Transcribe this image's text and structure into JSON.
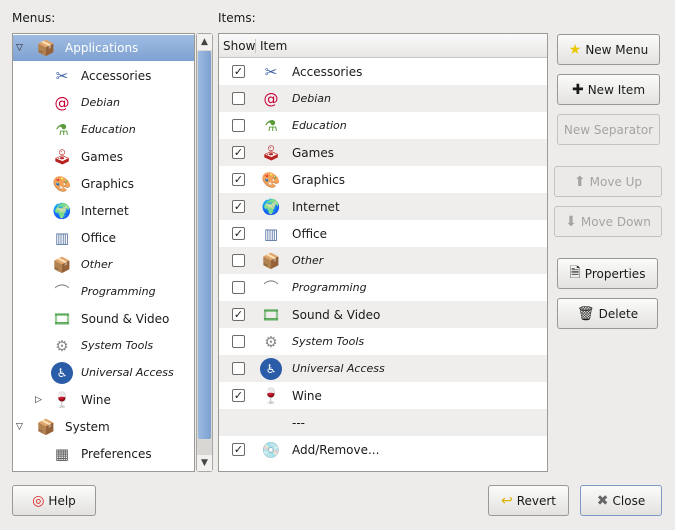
{
  "menus_label": "Menus:",
  "items_label": "Items:",
  "tree": [
    {
      "label": "Applications",
      "icon": "applications-icon",
      "expanded": true,
      "selected": true,
      "level": 0,
      "italic": false
    },
    {
      "label": "Accessories",
      "icon": "accessories-icon",
      "level": 1,
      "italic": false
    },
    {
      "label": "Debian",
      "icon": "debian-icon",
      "level": 1,
      "italic": true
    },
    {
      "label": "Education",
      "icon": "education-icon",
      "level": 1,
      "italic": true
    },
    {
      "label": "Games",
      "icon": "games-icon",
      "level": 1,
      "italic": false
    },
    {
      "label": "Graphics",
      "icon": "graphics-icon",
      "level": 1,
      "italic": false
    },
    {
      "label": "Internet",
      "icon": "internet-icon",
      "level": 1,
      "italic": false
    },
    {
      "label": "Office",
      "icon": "office-icon",
      "level": 1,
      "italic": false
    },
    {
      "label": "Other",
      "icon": "other-icon",
      "level": 1,
      "italic": true
    },
    {
      "label": "Programming",
      "icon": "programming-icon",
      "level": 1,
      "italic": true
    },
    {
      "label": "Sound & Video",
      "icon": "sound-video-icon",
      "level": 1,
      "italic": false
    },
    {
      "label": "System Tools",
      "icon": "system-tools-icon",
      "level": 1,
      "italic": true
    },
    {
      "label": "Universal Access",
      "icon": "universal-access-icon",
      "level": 1,
      "italic": true
    },
    {
      "label": "Wine",
      "icon": "wine-icon",
      "level": 1,
      "italic": false,
      "collapsed": true
    },
    {
      "label": "System",
      "icon": "system-icon",
      "level": 0,
      "italic": false,
      "expanded": true
    },
    {
      "label": "Preferences",
      "icon": "preferences-icon",
      "level": 1,
      "italic": false
    }
  ],
  "columns": {
    "show": "Show",
    "item": "Item"
  },
  "items": [
    {
      "label": "Accessories",
      "checked": true,
      "italic": false,
      "icon": "accessories-icon"
    },
    {
      "label": "Debian",
      "checked": false,
      "italic": true,
      "icon": "debian-icon"
    },
    {
      "label": "Education",
      "checked": false,
      "italic": true,
      "icon": "education-icon"
    },
    {
      "label": "Games",
      "checked": true,
      "italic": false,
      "icon": "games-icon"
    },
    {
      "label": "Graphics",
      "checked": true,
      "italic": false,
      "icon": "graphics-icon"
    },
    {
      "label": "Internet",
      "checked": true,
      "italic": false,
      "icon": "internet-icon"
    },
    {
      "label": "Office",
      "checked": true,
      "italic": false,
      "icon": "office-icon"
    },
    {
      "label": "Other",
      "checked": false,
      "italic": true,
      "icon": "other-icon"
    },
    {
      "label": "Programming",
      "checked": false,
      "italic": true,
      "icon": "programming-icon"
    },
    {
      "label": "Sound & Video",
      "checked": true,
      "italic": false,
      "icon": "sound-video-icon"
    },
    {
      "label": "System Tools",
      "checked": false,
      "italic": true,
      "icon": "system-tools-icon"
    },
    {
      "label": "Universal Access",
      "checked": false,
      "italic": true,
      "icon": "universal-access-icon"
    },
    {
      "label": "Wine",
      "checked": true,
      "italic": false,
      "icon": "wine-icon"
    },
    {
      "label": "---",
      "separator": true
    },
    {
      "label": "Add/Remove...",
      "checked": true,
      "italic": false,
      "icon": "add-remove-icon"
    }
  ],
  "buttons": {
    "new_menu": "New Menu",
    "new_item": "New Item",
    "new_separator": "New Separator",
    "move_up": "Move Up",
    "move_down": "Move Down",
    "properties": "Properties",
    "delete": "Delete",
    "help": "Help",
    "revert": "Revert",
    "close": "Close"
  }
}
